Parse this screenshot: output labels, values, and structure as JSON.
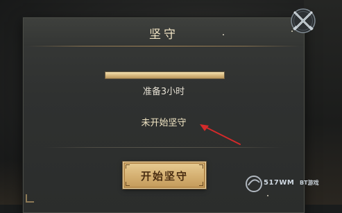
{
  "dialog": {
    "title": "坚守",
    "progress": 1.0,
    "prep_text": "准备3小时",
    "status_text": "未开始坚守",
    "start_button_label": "开始坚守",
    "close_icon": "crossed-swords-close-icon"
  },
  "annotation": {
    "arrow_color": "#d42a2a",
    "icon": "red-arrow-icon"
  },
  "watermark": {
    "logo_icon": "517wm-logo",
    "main_text": "517WM",
    "side_text": "BT游戏"
  },
  "colors": {
    "accent_gold": "#d6b274",
    "title_text": "#efe2c2",
    "panel_bg": "#2f3130"
  }
}
